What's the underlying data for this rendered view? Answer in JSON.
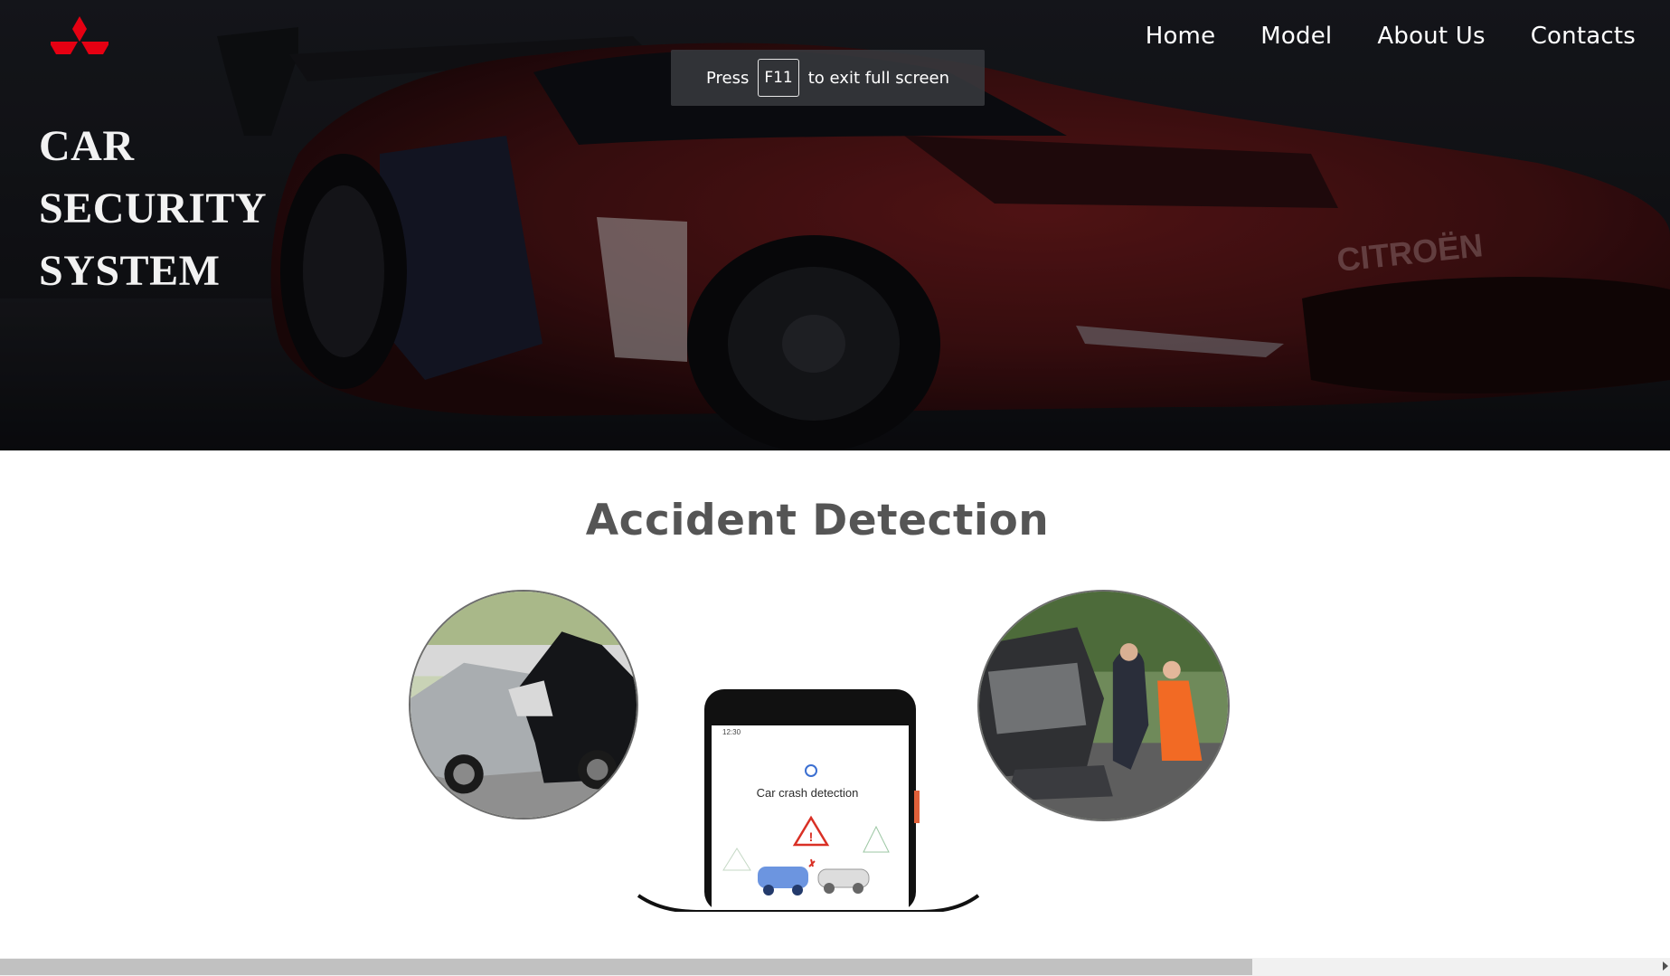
{
  "brand": {
    "logo_icon": "three-diamonds-logo-icon",
    "logo_color": "#e60012"
  },
  "nav": {
    "items": [
      {
        "label": "Home"
      },
      {
        "label": "Model"
      },
      {
        "label": "About Us"
      },
      {
        "label": "Contacts"
      }
    ]
  },
  "hero": {
    "title_lines": [
      "CAR",
      "SECURITY",
      "SYSTEM"
    ],
    "background": "dark red race car"
  },
  "fullscreen_notice": {
    "before": "Press",
    "key": "F11",
    "after": "to exit full screen"
  },
  "section": {
    "title": "Accident Detection",
    "phone_time": "12:30",
    "phone_caption": "Car crash detection"
  },
  "colors": {
    "title_gray": "#555555",
    "nav_text": "#ffffff",
    "scroll_thumb": "#c1c1c1"
  }
}
